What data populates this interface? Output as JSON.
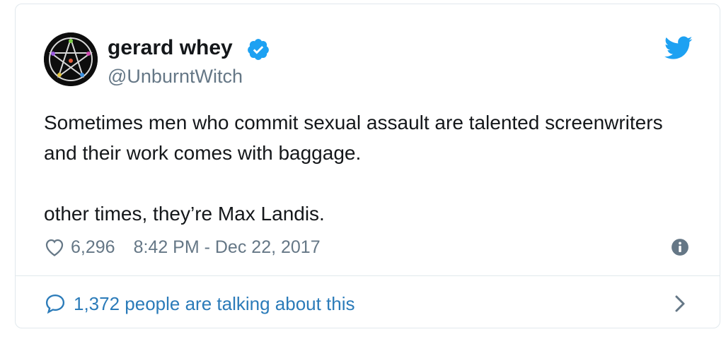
{
  "author": {
    "name": "gerard whey",
    "handle": "@UnburntWitch",
    "verified": true
  },
  "tweet": {
    "line1": "Sometimes men who commit sexual assault are talented screenwriters and their work comes with baggage.",
    "line2": "other times, they’re Max Landis."
  },
  "meta": {
    "likes": "6,296",
    "timestamp": "8:42 PM - Dec 22, 2017"
  },
  "footer": {
    "talking_label": "1,372 people are talking about this"
  },
  "icons": {
    "verified": "verified-badge-icon",
    "bird": "twitter-bird-icon",
    "heart": "heart-icon",
    "info": "info-icon",
    "bubble": "speech-bubble-icon",
    "chevron": "chevron-right-icon"
  },
  "colors": {
    "twitter_blue": "#1da1f2",
    "link_blue": "#2b7bb9",
    "secondary_text": "#657786",
    "primary_text": "#14171a",
    "border": "#e1e8ed"
  }
}
